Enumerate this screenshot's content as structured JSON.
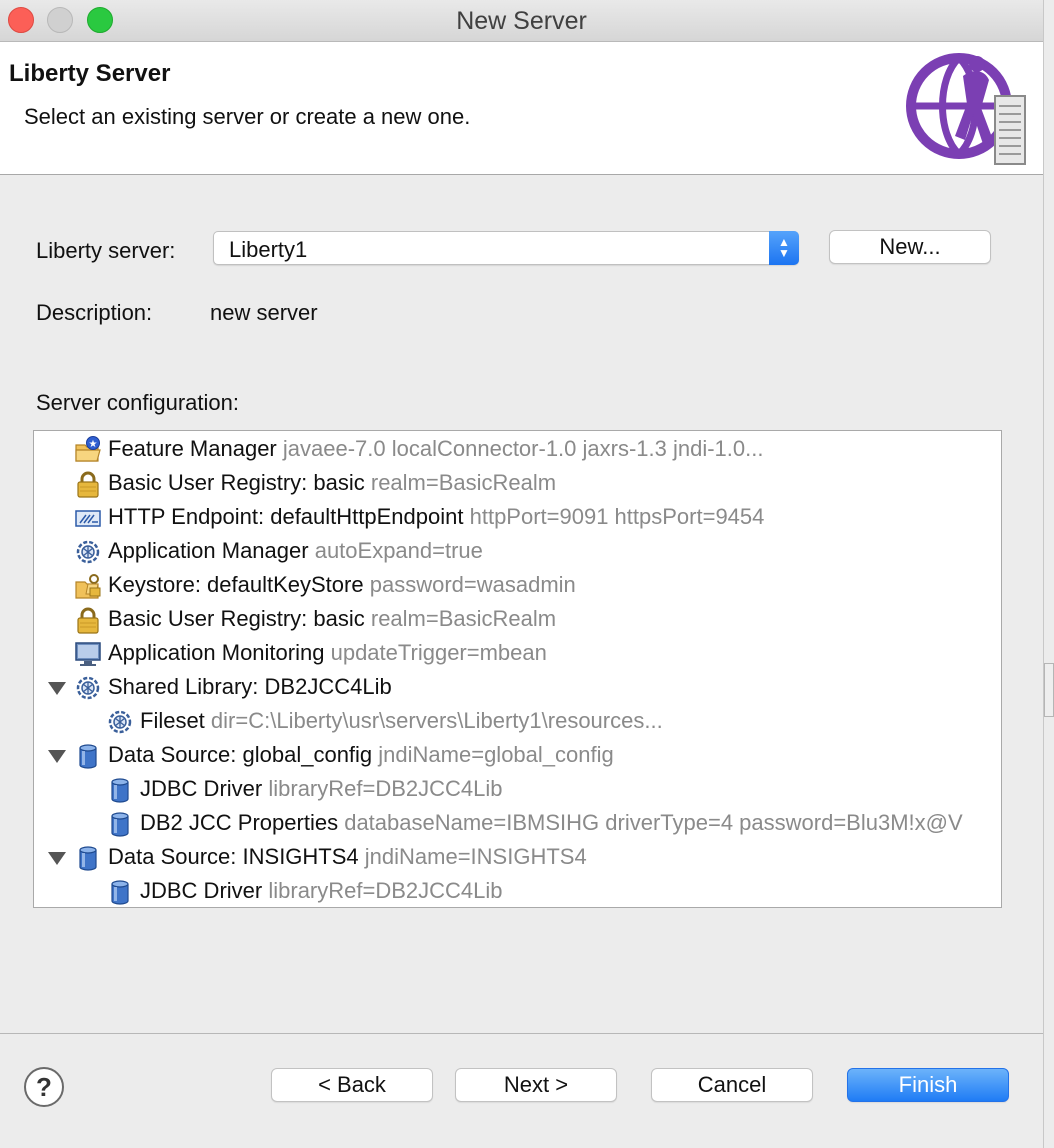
{
  "window": {
    "title": "New Server"
  },
  "banner": {
    "title": "Liberty Server",
    "description": "Select an existing server or create a new one."
  },
  "form": {
    "server_label": "Liberty server:",
    "server_value": "Liberty1",
    "new_button": "New...",
    "description_label": "Description:",
    "description_value": "new server",
    "config_label": "Server configuration:"
  },
  "tree": {
    "items": [
      {
        "name": "Feature Manager",
        "attr": "javaee-7.0 localConnector-1.0 jaxrs-1.3 jndi-1.0...",
        "icon": "feature-manager-icon",
        "level": 0,
        "expanded": null
      },
      {
        "name": "Basic User Registry: basic",
        "attr": "realm=BasicRealm",
        "icon": "lock-icon",
        "level": 0,
        "expanded": null
      },
      {
        "name": "HTTP Endpoint: defaultHttpEndpoint",
        "attr": "httpPort=9091 httpsPort=9454",
        "icon": "http-endpoint-icon",
        "level": 0,
        "expanded": null
      },
      {
        "name": "Application Manager",
        "attr": "autoExpand=true",
        "icon": "gear-globe-icon",
        "level": 0,
        "expanded": null
      },
      {
        "name": "Keystore: defaultKeyStore",
        "attr": "password=wasadmin",
        "icon": "keystore-icon",
        "level": 0,
        "expanded": null
      },
      {
        "name": "Basic User Registry: basic",
        "attr": "realm=BasicRealm",
        "icon": "lock-icon",
        "level": 0,
        "expanded": null
      },
      {
        "name": "Application Monitoring",
        "attr": "updateTrigger=mbean",
        "icon": "monitor-icon",
        "level": 0,
        "expanded": null
      },
      {
        "name": "Shared Library: DB2JCC4Lib",
        "attr": "",
        "icon": "gear-globe-icon",
        "level": 0,
        "expanded": true
      },
      {
        "name": "Fileset",
        "attr": "dir=C:\\Liberty\\usr\\servers\\Liberty1\\resources...",
        "icon": "gear-globe-icon",
        "level": 1,
        "expanded": null
      },
      {
        "name": "Data Source: global_config",
        "attr": "jndiName=global_config",
        "icon": "database-icon",
        "level": 0,
        "expanded": true
      },
      {
        "name": "JDBC Driver",
        "attr": "libraryRef=DB2JCC4Lib",
        "icon": "database-icon",
        "level": 1,
        "expanded": null
      },
      {
        "name": "DB2 JCC Properties",
        "attr": "databaseName=IBMSIHG driverType=4 password=Blu3M!x@V",
        "icon": "database-icon",
        "level": 1,
        "expanded": null
      },
      {
        "name": "Data Source: INSIGHTS4",
        "attr": "jndiName=INSIGHTS4",
        "icon": "database-icon",
        "level": 0,
        "expanded": true
      },
      {
        "name": "JDBC Driver",
        "attr": "libraryRef=DB2JCC4Lib",
        "icon": "database-icon",
        "level": 1,
        "expanded": null
      }
    ]
  },
  "footer": {
    "help": "?",
    "back": "< Back",
    "next": "Next >",
    "cancel": "Cancel",
    "finish": "Finish"
  },
  "colors": {
    "accent": "#1f7cf5",
    "banner_logo": "#7b3fb3",
    "attr_text": "#8a8a8a"
  }
}
